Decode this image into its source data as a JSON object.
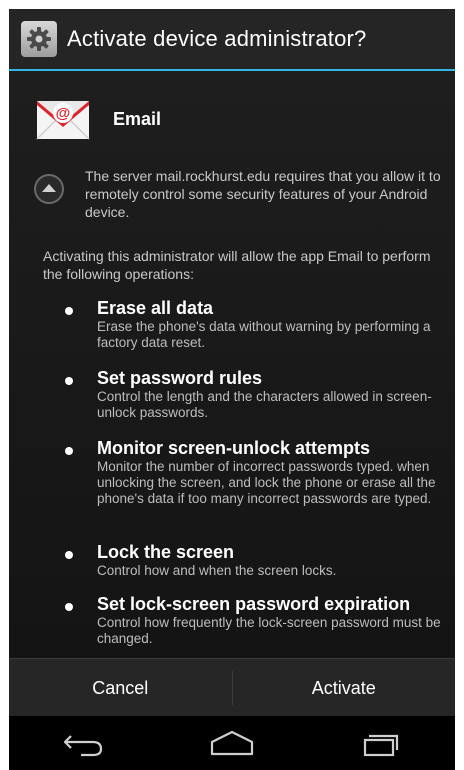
{
  "dialog": {
    "title": "Activate device administrator?",
    "icon": "settings-gear-icon"
  },
  "app": {
    "name": "Email",
    "icon": "email-envelope-icon"
  },
  "server_notice": "The server mail.rockhurst.edu requires that you allow it to remotely control some security features of your Android device.",
  "intro": "Activating this administrator will allow the app Email to perform the following operations:",
  "policies": [
    {
      "title": "Erase all data",
      "description": "Erase the phone's data without warning by performing a factory data reset."
    },
    {
      "title": "Set password rules",
      "description": "Control the length and the characters allowed in screen-unlock passwords."
    },
    {
      "title": "Monitor screen-unlock attempts",
      "description": "Monitor the number of incorrect passwords typed. when unlocking the screen, and lock the phone or erase all the phone's data if too many incorrect passwords are typed."
    },
    {
      "title": "Lock the screen",
      "description": "Control how and when the screen locks."
    },
    {
      "title": "Set lock-screen password expiration",
      "description": "Control how frequently the lock-screen password must be changed."
    }
  ],
  "buttons": {
    "cancel": "Cancel",
    "activate": "Activate"
  },
  "navbar": {
    "back": "back-icon",
    "home": "home-icon",
    "recents": "recent-apps-icon"
  },
  "colors": {
    "accent": "#33b5e5",
    "background": "#1b1b1b"
  }
}
